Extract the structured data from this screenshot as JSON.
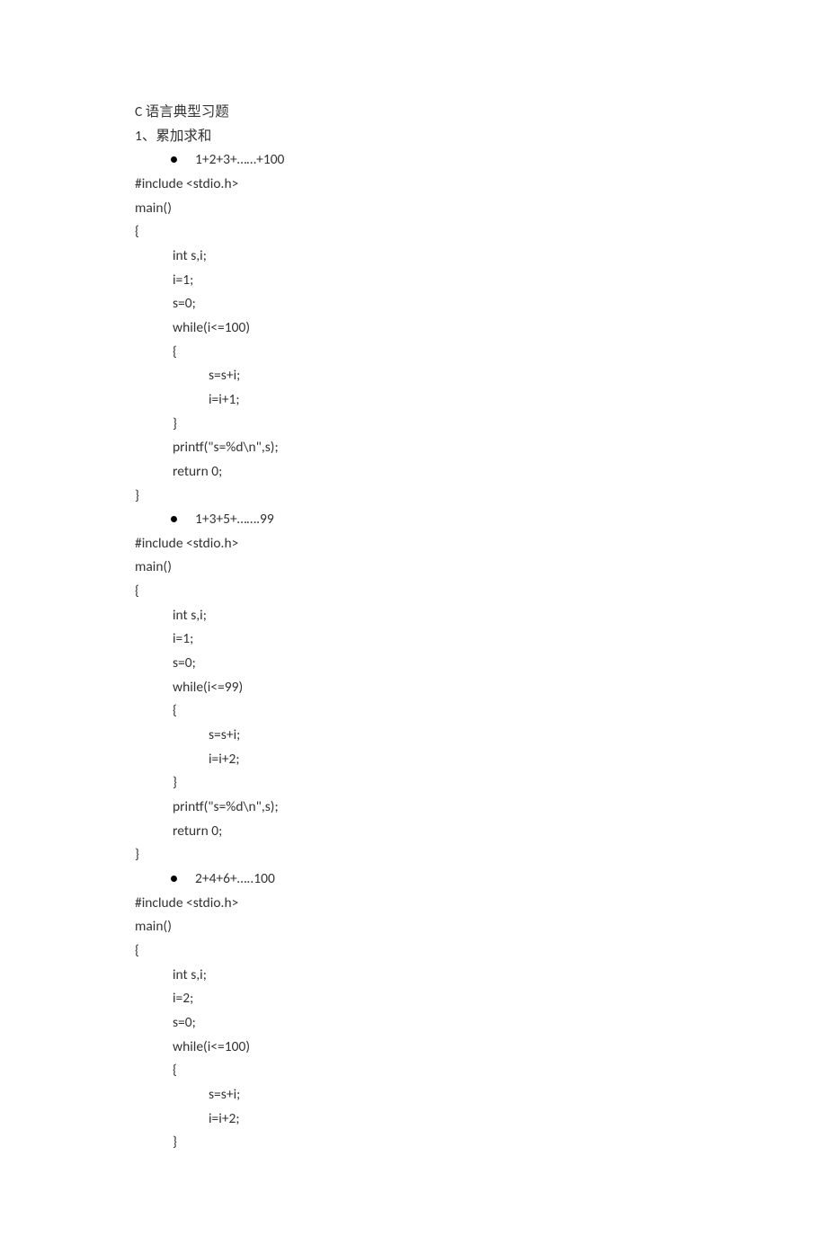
{
  "title": "C 语言典型习题",
  "section1": {
    "number": "1、",
    "label": "累加求和",
    "bullet1": "1+2+3+……+100",
    "code1": {
      "l1": "#include <stdio.h>",
      "l2": "main()",
      "l3": "{",
      "l4": "int s,i;",
      "l5": "i=1;",
      "l6": "s=0;",
      "l7": "while(i<=100)",
      "l8": "{",
      "l9": "s=s+i;",
      "l10": "i=i+1;",
      "l11": "}",
      "l12": "printf(\"s=%d\\n\",s);",
      "l13": "return 0;",
      "l14": "}"
    },
    "bullet2": "1+3+5+…….99",
    "code2": {
      "l1": "#include <stdio.h>",
      "l2": "main()",
      "l3": "{",
      "l4": "int s,i;",
      "l5": "i=1;",
      "l6": "s=0;",
      "l7": "while(i<=99)",
      "l8": "{",
      "l9": "s=s+i;",
      "l10": "i=i+2;",
      "l11": "}",
      "l12": "printf(\"s=%d\\n\",s);",
      "l13": "return 0;",
      "l14": "}"
    },
    "bullet3": "2+4+6+…..100",
    "code3": {
      "l1": "#include <stdio.h>",
      "l2": "main()",
      "l3": "{",
      "l4": "int s,i;",
      "l5": "i=2;",
      "l6": "s=0;",
      "l7": "while(i<=100)",
      "l8": "{",
      "l9": "s=s+i;",
      "l10": "i=i+2;",
      "l11": "}"
    }
  }
}
